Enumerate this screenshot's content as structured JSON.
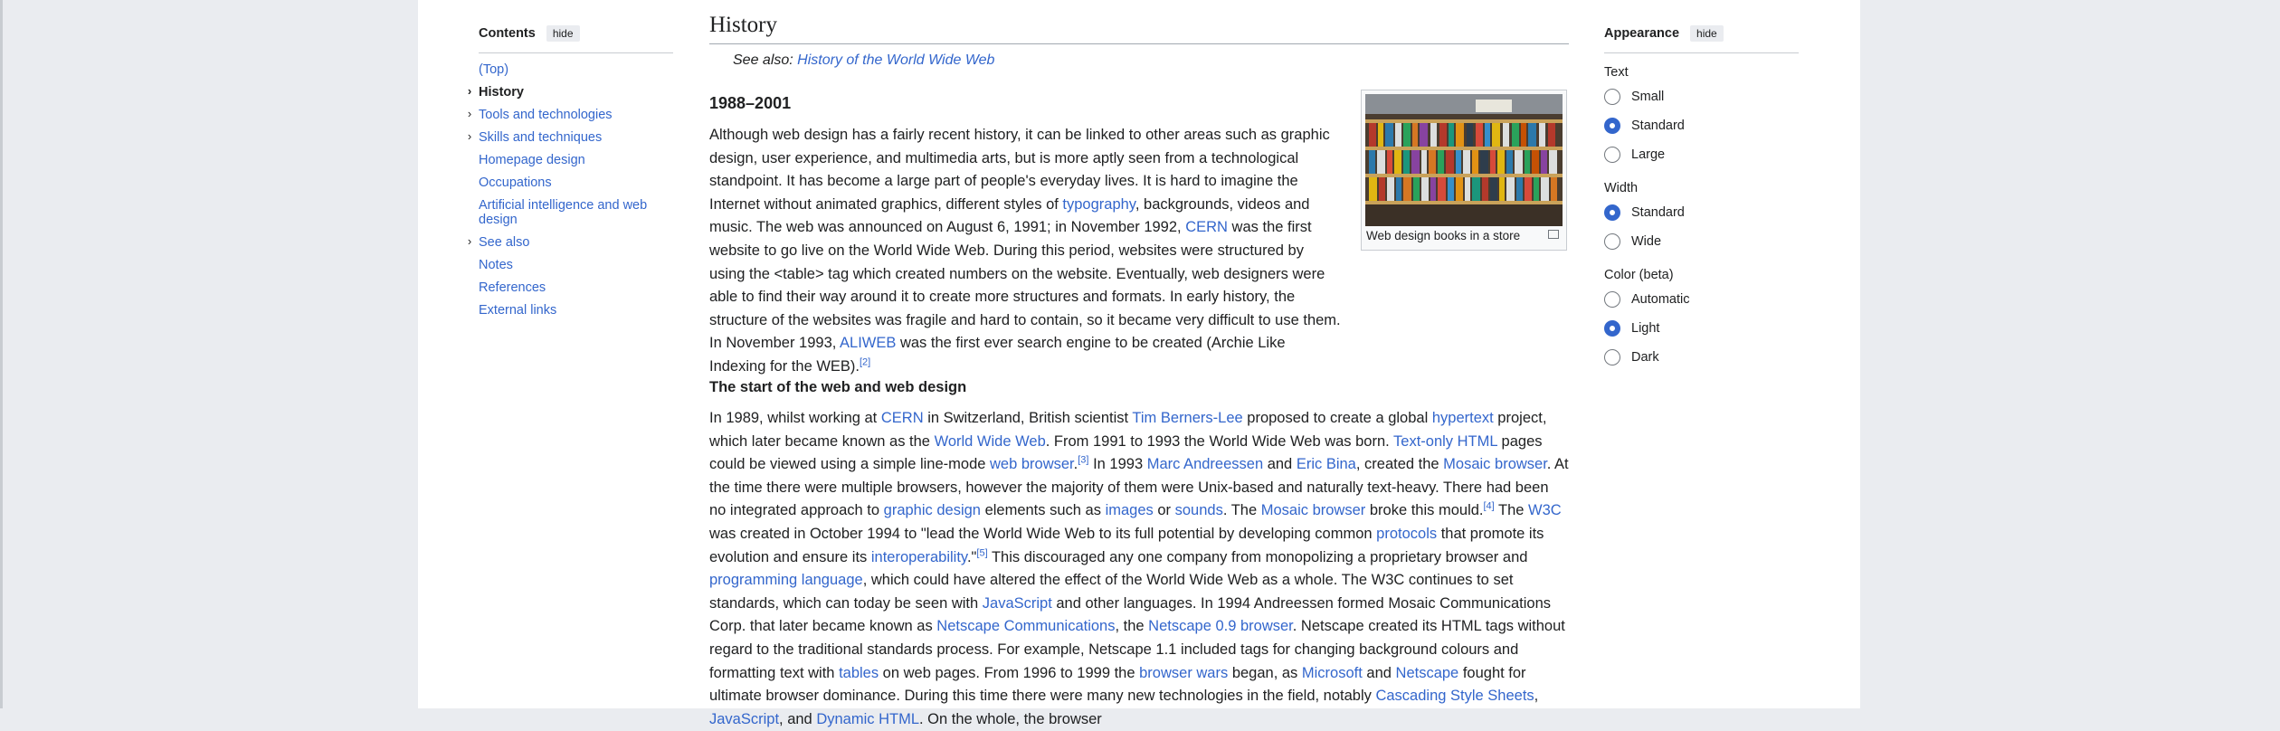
{
  "toc": {
    "title": "Contents",
    "hide_label": "hide",
    "items": [
      {
        "label": "(Top)",
        "chevron": false,
        "active": false
      },
      {
        "label": "History",
        "chevron": true,
        "active": true
      },
      {
        "label": "Tools and technologies",
        "chevron": true,
        "active": false
      },
      {
        "label": "Skills and techniques",
        "chevron": true,
        "active": false
      },
      {
        "label": "Homepage design",
        "chevron": false,
        "active": false
      },
      {
        "label": "Occupations",
        "chevron": false,
        "active": false
      },
      {
        "label": "Artificial intelligence and web design",
        "chevron": false,
        "active": false
      },
      {
        "label": "See also",
        "chevron": true,
        "active": false
      },
      {
        "label": "Notes",
        "chevron": false,
        "active": false
      },
      {
        "label": "References",
        "chevron": false,
        "active": false
      },
      {
        "label": "External links",
        "chevron": false,
        "active": false
      }
    ]
  },
  "article": {
    "section_title": "History",
    "hatnote_prefix": "See also: ",
    "hatnote_link": "History of the World Wide Web",
    "subsection_1": "1988–2001",
    "subsection_2": "The start of the web and web design",
    "figure_caption": "Web design books in a store",
    "para1": [
      {
        "t": "Although web design has a fairly recent history, it can be linked to other areas such as graphic design, user experience, and multimedia arts, but is more aptly seen from a technological standpoint. It has become a large part of people's everyday lives. It is hard to imagine the Internet without animated graphics, different styles of "
      },
      {
        "l": "typography"
      },
      {
        "t": ", backgrounds, videos and music. The web was announced on August 6, 1991; in November 1992, "
      },
      {
        "l": "CERN"
      },
      {
        "t": " was the first website to go live on the World Wide Web. During this period, websites were structured by using the <table> tag which created numbers on the website. Eventually, web designers were able to find their way around it to create more structures and formats. In early history, the structure of the websites was fragile and hard to contain, so it became very difficult to use them. In November 1993, "
      },
      {
        "l": "ALIWEB"
      },
      {
        "t": " was the first ever search engine to be created (Archie Like Indexing for the WEB)."
      },
      {
        "s": "[2]"
      }
    ],
    "para2": [
      {
        "t": "In 1989, whilst working at "
      },
      {
        "l": "CERN"
      },
      {
        "t": " in Switzerland, British scientist "
      },
      {
        "l": "Tim Berners-Lee"
      },
      {
        "t": " proposed to create a global "
      },
      {
        "l": "hypertext"
      },
      {
        "t": " project, which later became known as the "
      },
      {
        "l": "World Wide Web"
      },
      {
        "t": ". From 1991 to 1993 the World Wide Web was born. "
      },
      {
        "l": "Text-only HTML"
      },
      {
        "t": " pages could be viewed using a simple line-mode "
      },
      {
        "l": "web browser"
      },
      {
        "t": "."
      },
      {
        "s": "[3]"
      },
      {
        "t": " In 1993 "
      },
      {
        "l": "Marc Andreessen"
      },
      {
        "t": " and "
      },
      {
        "l": "Eric Bina"
      },
      {
        "t": ", created the "
      },
      {
        "l": "Mosaic browser"
      },
      {
        "t": ". At the time there were multiple browsers, however the majority of them were Unix-based and naturally text-heavy. There had been no integrated approach to "
      },
      {
        "l": "graphic design"
      },
      {
        "t": " elements such as "
      },
      {
        "l": "images"
      },
      {
        "t": " or "
      },
      {
        "l": "sounds"
      },
      {
        "t": ". The "
      },
      {
        "l": "Mosaic browser"
      },
      {
        "t": " broke this mould."
      },
      {
        "s": "[4]"
      },
      {
        "t": " The "
      },
      {
        "l": "W3C"
      },
      {
        "t": " was created in October 1994 to \"lead the World Wide Web to its full potential by developing common "
      },
      {
        "l": "protocols"
      },
      {
        "t": " that promote its evolution and ensure its "
      },
      {
        "l": "interoperability"
      },
      {
        "t": ".\""
      },
      {
        "s": "[5]"
      },
      {
        "t": " This discouraged any one company from monopolizing a proprietary browser and "
      },
      {
        "l": "programming language"
      },
      {
        "t": ", which could have altered the effect of the World Wide Web as a whole. The W3C continues to set standards, which can today be seen with "
      },
      {
        "l": "JavaScript"
      },
      {
        "t": " and other languages. In 1994 Andreessen formed Mosaic Communications Corp. that later became known as "
      },
      {
        "l": "Netscape Communications"
      },
      {
        "t": ", the "
      },
      {
        "l": "Netscape 0.9 browser"
      },
      {
        "t": ". Netscape created its HTML tags without regard to the traditional standards process. For example, Netscape 1.1 included tags for changing background colours and formatting text with "
      },
      {
        "l": "tables"
      },
      {
        "t": " on web pages. From 1996 to 1999 the "
      },
      {
        "l": "browser wars"
      },
      {
        "t": " began, as "
      },
      {
        "l": "Microsoft"
      },
      {
        "t": " and "
      },
      {
        "l": "Netscape"
      },
      {
        "t": " fought for ultimate browser dominance. During this time there were many new technologies in the field, notably "
      },
      {
        "l": "Cascading Style Sheets"
      },
      {
        "t": ", "
      },
      {
        "l": "JavaScript"
      },
      {
        "t": ", and "
      },
      {
        "l": "Dynamic HTML"
      },
      {
        "t": ". On the whole, the browser"
      }
    ]
  },
  "appearance": {
    "title": "Appearance",
    "hide_label": "hide",
    "groups": [
      {
        "label": "Text",
        "options": [
          {
            "label": "Small",
            "selected": false
          },
          {
            "label": "Standard",
            "selected": true
          },
          {
            "label": "Large",
            "selected": false
          }
        ]
      },
      {
        "label": "Width",
        "options": [
          {
            "label": "Standard",
            "selected": true
          },
          {
            "label": "Wide",
            "selected": false
          }
        ]
      },
      {
        "label": "Color (beta)",
        "options": [
          {
            "label": "Automatic",
            "selected": false
          },
          {
            "label": "Light",
            "selected": true
          },
          {
            "label": "Dark",
            "selected": false
          }
        ]
      }
    ]
  },
  "colors": {
    "link": "#3366cc",
    "accent": "#3366cc",
    "text": "#202122"
  }
}
